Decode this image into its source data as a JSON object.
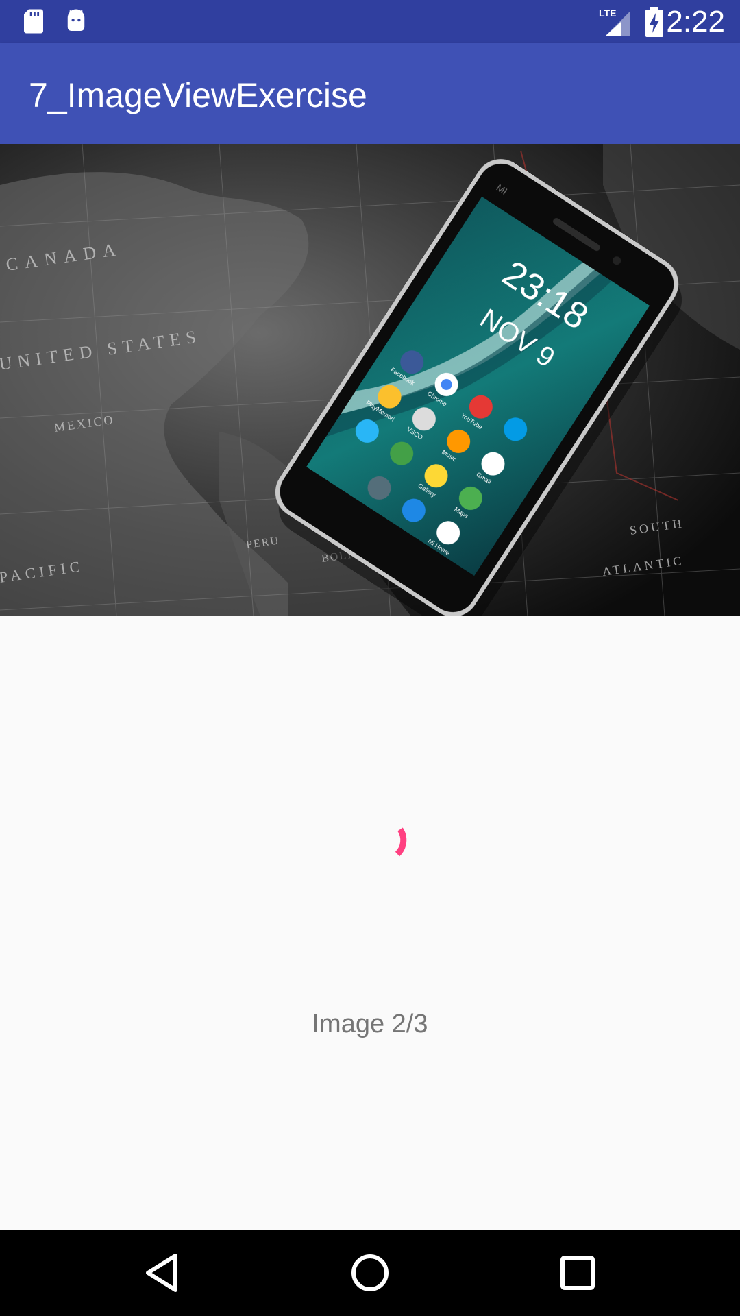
{
  "status_bar": {
    "time": "2:22",
    "network_label": "LTE",
    "icons": [
      "sd-card-icon",
      "android-icon",
      "lte-signal-icon",
      "battery-charging-icon"
    ],
    "background_color": "#303f9f"
  },
  "app_bar": {
    "title": "7_ImageViewExercise",
    "background_color": "#3f51b5"
  },
  "image_view": {
    "phone_clock": "23:18",
    "phone_date": "NOV 9",
    "map_labels": [
      "CANADA",
      "UNITED STATES",
      "MEXICO",
      "PACIFIC",
      "PERU",
      "BOLIVIA",
      "SOUTH",
      "ATLANTIC"
    ],
    "app_labels": [
      "Facebook",
      "Chrome",
      "YouTube",
      "PlayMemori",
      "VSCO",
      "Music",
      "Gmail",
      "Maps",
      "Gallery",
      "Mi Home"
    ]
  },
  "progress": {
    "icon": "loading-spinner-icon",
    "color": "#ff4081"
  },
  "caption": {
    "text": "Image 2/3"
  },
  "nav_bar": {
    "icons": [
      "back-icon",
      "home-icon",
      "recents-icon"
    ]
  }
}
